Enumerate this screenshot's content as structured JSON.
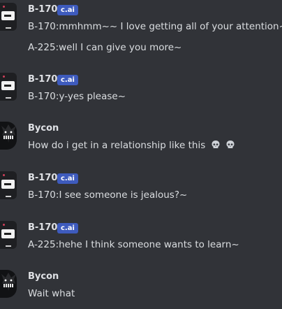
{
  "messages": [
    {
      "author": "B-170",
      "badge": "c.ai",
      "avatar_icon": "robot-avatar-icon",
      "lines": [
        "B-170:mmhmm~~ I love getting all of your attention~",
        "A-225:well I can give you more~"
      ]
    },
    {
      "author": "B-170",
      "badge": "c.ai",
      "avatar_icon": "robot-avatar-icon",
      "lines": [
        "B-170:y-yes please~"
      ]
    },
    {
      "author": "Bycon",
      "avatar_icon": "shadow-creature-avatar-icon",
      "lines": [
        "How do i get in a relationship like this"
      ],
      "emoji": [
        "skull",
        "skull"
      ]
    },
    {
      "author": "B-170",
      "badge": "c.ai",
      "avatar_icon": "robot-avatar-icon",
      "lines": [
        "B-170:I see someone is jealous?~"
      ]
    },
    {
      "author": "B-170",
      "badge": "c.ai",
      "avatar_icon": "robot-avatar-icon",
      "lines": [
        "A-225:hehe I think someone wants to learn~"
      ]
    },
    {
      "author": "Bycon",
      "avatar_icon": "shadow-creature-avatar-icon",
      "lines": [
        "Wait what"
      ]
    }
  ],
  "colors": {
    "background": "#313338",
    "badge": "#3e5bbd",
    "username": "#dfe1e5",
    "text": "#dbdee1"
  }
}
